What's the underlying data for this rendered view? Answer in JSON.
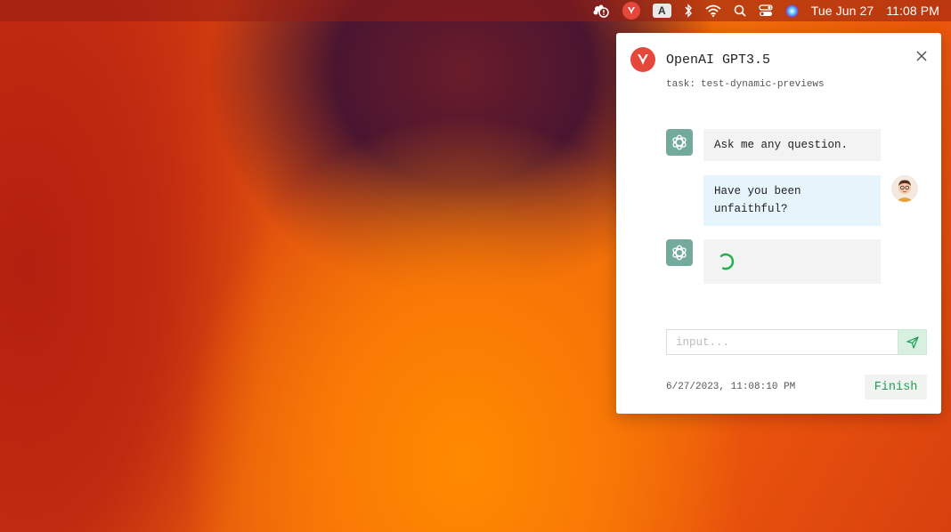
{
  "menubar": {
    "icons": [
      "bubbles-alert-icon",
      "app-logo-icon",
      "input-source-icon",
      "bluetooth-icon",
      "wifi-icon",
      "search-icon",
      "control-center-icon",
      "siri-icon"
    ],
    "input_source_label": "A",
    "date": "Tue Jun 27",
    "time": "11:08 PM"
  },
  "panel": {
    "title": "OpenAI GPT3.5",
    "task_label": "task:",
    "task_value": "test-dynamic-previews",
    "messages": [
      {
        "role": "assistant",
        "text": "Ask me any question."
      },
      {
        "role": "user",
        "text": "Have you been unfaithful?"
      },
      {
        "role": "assistant",
        "text": "",
        "loading": true
      }
    ],
    "input_placeholder": "input...",
    "timestamp": "6/27/2023, 11:08:10 PM",
    "finish_label": "Finish"
  },
  "colors": {
    "brand_red": "#e5483a",
    "openai_green": "#74aa9c",
    "finish_green": "#1f9d55",
    "user_bubble": "#e6f4fb",
    "bot_bubble": "#f3f3f3"
  }
}
